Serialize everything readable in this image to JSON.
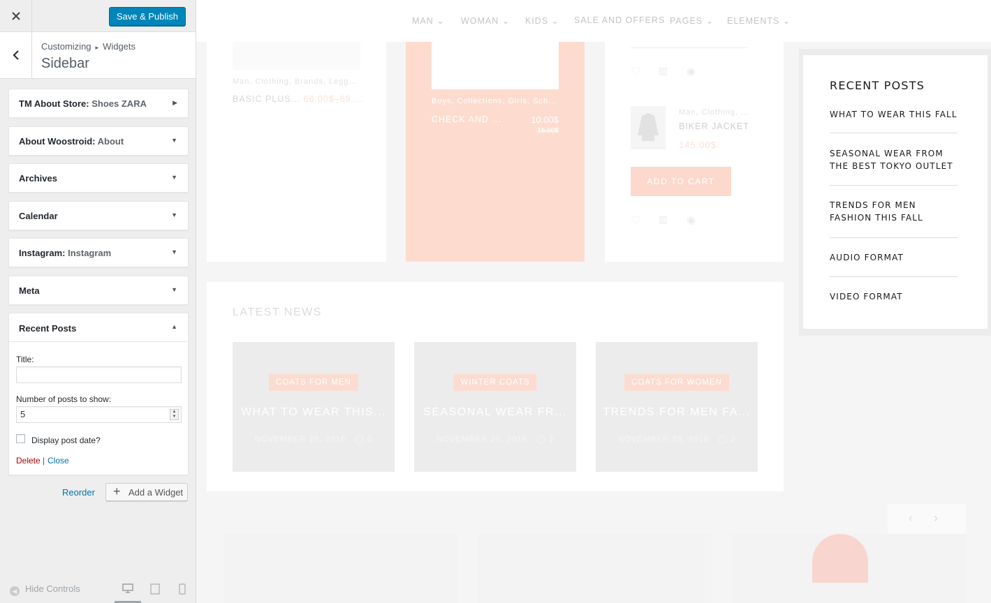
{
  "customizer": {
    "close_icon": "close-icon",
    "publish_label": "Save & Publish",
    "breadcrumb": {
      "root": "Customizing",
      "current": "Widgets"
    },
    "section_title": "Sidebar",
    "widgets": [
      {
        "name": "TM About Store:",
        "sub": " Shoes ZARA",
        "arrow": "▶"
      },
      {
        "name": "About Woostroid:",
        "sub": " About",
        "arrow": "▼"
      },
      {
        "name": "Archives",
        "sub": "",
        "arrow": "▼"
      },
      {
        "name": "Calendar",
        "sub": "",
        "arrow": "▼"
      },
      {
        "name": "Instagram:",
        "sub": " Instagram",
        "arrow": "▼"
      },
      {
        "name": "Meta",
        "sub": "",
        "arrow": "▼"
      }
    ],
    "recent_posts_widget": {
      "name": "Recent Posts",
      "arrow": "▲",
      "title_label": "Title:",
      "title_value": "",
      "count_label": "Number of posts to show:",
      "count_value": "5",
      "date_label": "Display post date?",
      "date_checked": false,
      "delete_label": "Delete",
      "separator": "|",
      "close_label": "Close"
    },
    "reorder_label": "Reorder",
    "add_widget_label": "Add a Widget",
    "hide_controls_label": "Hide Controls"
  },
  "preview": {
    "nav": [
      {
        "label": "MAN",
        "chevron": true
      },
      {
        "label": "WOMAN",
        "chevron": true
      },
      {
        "label": "KIDS",
        "chevron": true
      },
      {
        "label": "SALE AND OFFERS",
        "chevron": false
      },
      {
        "label": "PAGES",
        "chevron": true
      },
      {
        "label": "ELEMENTS",
        "chevron": true
      }
    ],
    "products": {
      "p1_cats": "Man, Clothing, Brands, Legg...",
      "p1_name": "BASIC PLUS...",
      "p1_price": "66.00$–69....",
      "p2_cats": "Boys, Collections, Girls, Sch...",
      "p2_name": "CHECK AND ...",
      "p2_price": "10.00$",
      "p2_old_price": "15.00$",
      "p3_cats": "Man, Clothing, ...",
      "p3_name": "BIKER JACKET",
      "p3_price": "145.00$",
      "add_to_cart": "ADD TO CART"
    },
    "latest_news": {
      "heading": "LATEST NEWS",
      "items": [
        {
          "tag": "COATS FOR MEN",
          "title": "WHAT TO WEAR THIS...",
          "date": "NOVEMBER 26, 2016",
          "comments": "0"
        },
        {
          "tag": "WINTER COATS",
          "title": "SEASONAL WEAR FR...",
          "date": "NOVEMBER 26, 2016",
          "comments": "2"
        },
        {
          "tag": "COATS FOR WOMEN",
          "title": "TRENDS FOR MEN FA...",
          "date": "NOVEMBER 26, 2016",
          "comments": "2"
        }
      ]
    },
    "recent_posts": {
      "title": "RECENT POSTS",
      "items": [
        "WHAT TO WEAR THIS FALL",
        "SEASONAL WEAR FROM THE BEST TOKYO OUTLET",
        "TRENDS FOR MEN FASHION THIS FALL",
        "AUDIO FORMAT",
        "VIDEO FORMAT"
      ]
    }
  },
  "colors": {
    "primary_button": "#0085ba",
    "link": "#0073aa",
    "delete": "#a00",
    "accent_peach": "#fbd9cc"
  }
}
